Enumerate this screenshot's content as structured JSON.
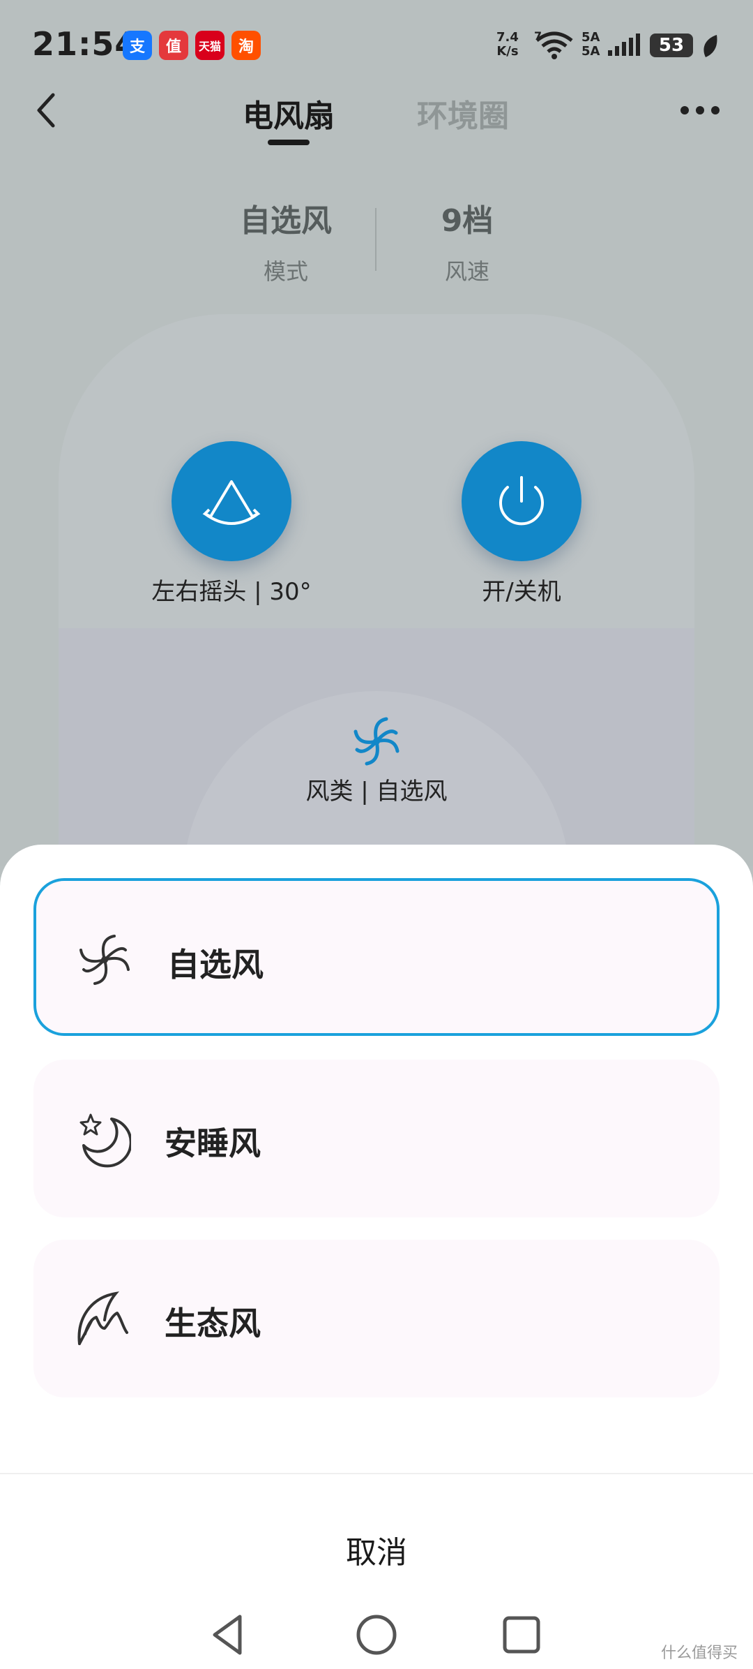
{
  "status_bar": {
    "time": "21:54",
    "app_icons": [
      {
        "name": "alipay-icon",
        "glyph": "支",
        "color": "#1677ff"
      },
      {
        "name": "smzdm-icon",
        "glyph": "值",
        "color": "#e4393c"
      },
      {
        "name": "tmall-icon",
        "glyph": "天猫",
        "color": "#d9001b"
      },
      {
        "name": "taobao-icon",
        "glyph": "淘",
        "color": "#ff5000"
      }
    ],
    "net_speed_value": "7.4",
    "net_speed_unit": "K/s",
    "wifi_tag": "7",
    "sim1": "5A",
    "sim2": "5A",
    "battery": "53"
  },
  "header": {
    "tab_active": "电风扇",
    "tab_inactive": "环境圈"
  },
  "stats": {
    "mode_value": "自选风",
    "mode_label": "模式",
    "speed_value": "9档",
    "speed_label": "风速"
  },
  "controls": {
    "swing_label": "左右摇头 | 30°",
    "power_label": "开/关机",
    "wind_type_label": "风类 | 自选风"
  },
  "sheet": {
    "options": [
      {
        "label": "自选风",
        "icon": "fan-icon",
        "selected": true
      },
      {
        "label": "安睡风",
        "icon": "moon-star-icon",
        "selected": false
      },
      {
        "label": "生态风",
        "icon": "leaf-icon",
        "selected": false
      }
    ],
    "cancel": "取消"
  },
  "watermark": "什么值得买",
  "colors": {
    "accent": "#1287c8",
    "selected_border": "#1aa1dc",
    "option_bg": "#fdf8fc",
    "overlay_bg": "#b8bfbf"
  }
}
